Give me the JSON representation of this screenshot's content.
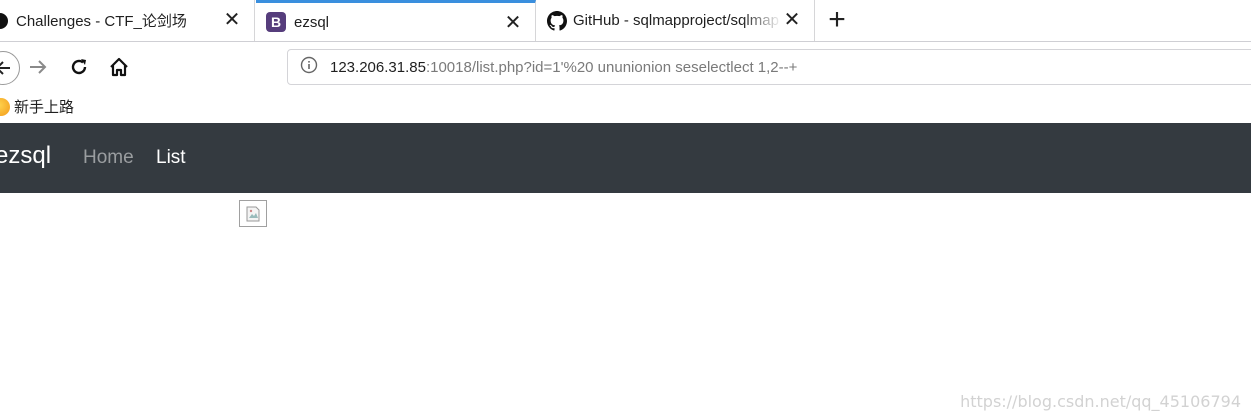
{
  "tabs": [
    {
      "title": "Challenges - CTF_论剑场",
      "close": "✕"
    },
    {
      "title": "ezsql",
      "favicon_letter": "B",
      "close": "✕"
    },
    {
      "title": "GitHub - sqlmapproject/sqlmap",
      "close": "✕"
    }
  ],
  "new_tab_label": "+",
  "address_bar": {
    "host": "123.206.31.85",
    "rest": ":10018/list.php?id=1'%20 ununionion seselectlect 1,2--+"
  },
  "bookmarks": [
    {
      "label": "新手上路"
    }
  ],
  "site": {
    "brand": "ezsql",
    "nav": [
      {
        "label": "Home"
      },
      {
        "label": "List"
      }
    ]
  },
  "watermark": "https://blog.csdn.net/qq_45106794",
  "colors": {
    "navbar_bg": "#343a40",
    "active_tab_accent": "#3a8fde",
    "bootstrap_purple": "#563d7c"
  }
}
